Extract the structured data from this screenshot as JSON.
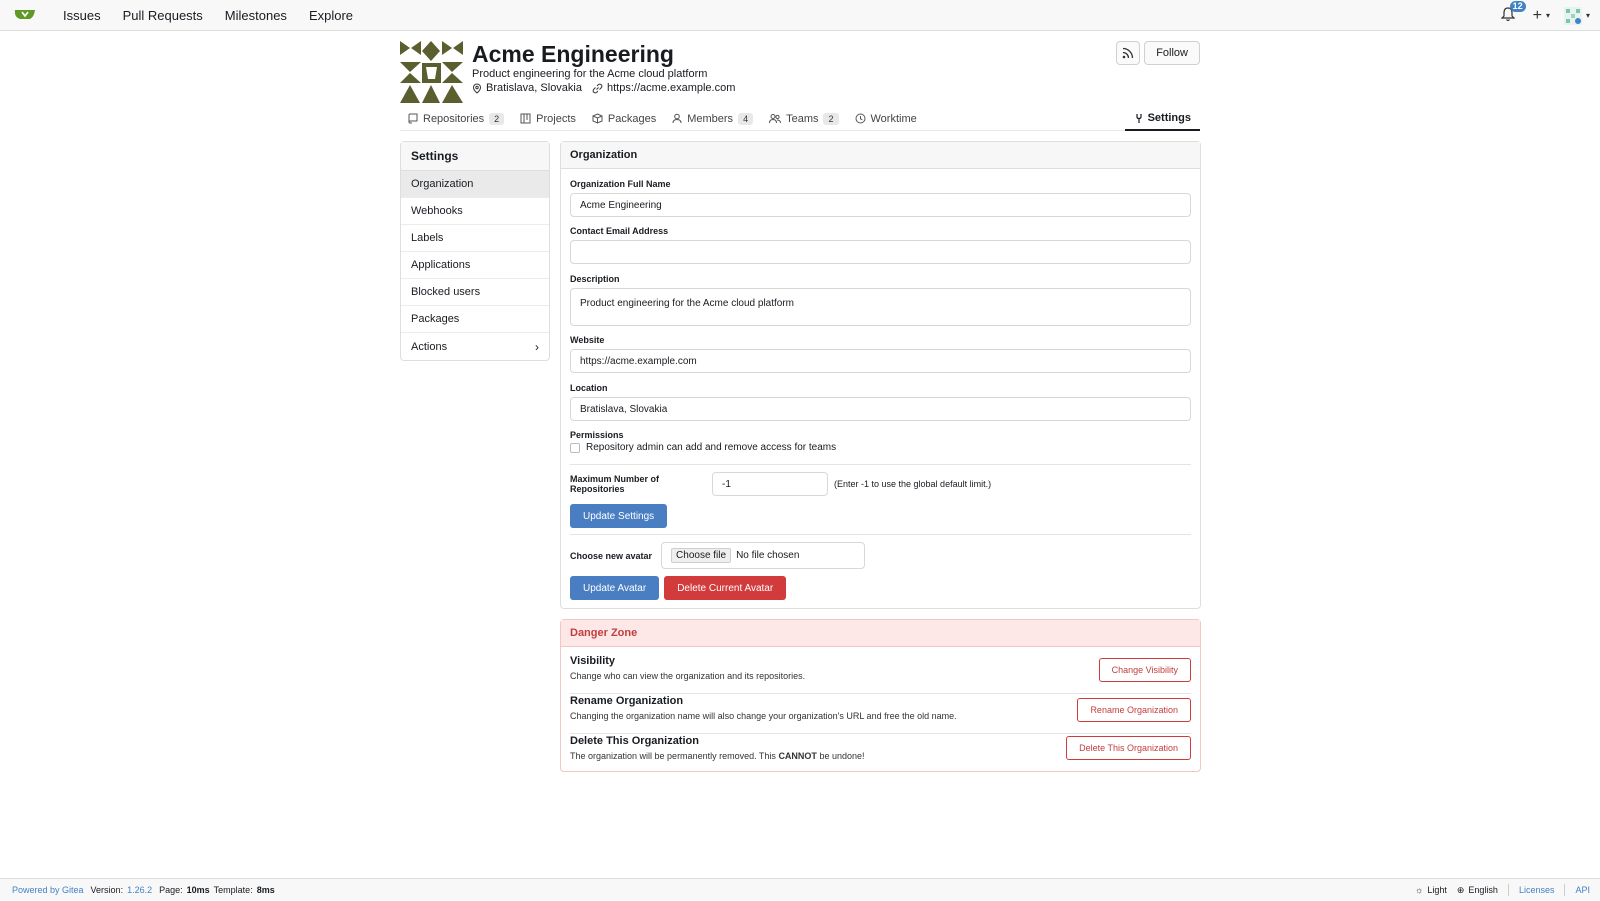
{
  "nav": {
    "links": [
      "Issues",
      "Pull Requests",
      "Milestones",
      "Explore"
    ],
    "notification_count": "12",
    "plus_label": "+"
  },
  "org": {
    "name": "Acme Engineering",
    "description": "Product engineering for the Acme cloud platform",
    "location": "Bratislava, Slovakia",
    "website": "https://acme.example.com",
    "follow_label": "Follow"
  },
  "tabs": [
    {
      "label": "Repositories",
      "count": "2"
    },
    {
      "label": "Projects"
    },
    {
      "label": "Packages"
    },
    {
      "label": "Members",
      "count": "4"
    },
    {
      "label": "Teams",
      "count": "2"
    },
    {
      "label": "Worktime"
    }
  ],
  "settings_tab": "Settings",
  "sidebar": {
    "title": "Settings",
    "items": [
      "Organization",
      "Webhooks",
      "Labels",
      "Applications",
      "Blocked users",
      "Packages",
      "Actions"
    ]
  },
  "form": {
    "title": "Organization",
    "full_name_label": "Organization Full Name",
    "full_name": "Acme Engineering",
    "email_label": "Contact Email Address",
    "email": "",
    "description_label": "Description",
    "description": "Product engineering for the Acme cloud platform",
    "website_label": "Website",
    "website": "https://acme.example.com",
    "location_label": "Location",
    "location": "Bratislava, Slovakia",
    "permissions_label": "Permissions",
    "permissions_checkbox": "Repository admin can add and remove access for teams",
    "max_repos_label": "Maximum Number of Repositories",
    "max_repos_value": "-1",
    "max_repos_hint": "(Enter -1 to use the global default limit.)",
    "update_settings": "Update Settings",
    "avatar_label": "Choose new avatar",
    "choose_file": "Choose file",
    "no_file": "No file chosen",
    "update_avatar": "Update Avatar",
    "delete_avatar": "Delete Current Avatar"
  },
  "danger": {
    "title": "Danger Zone",
    "visibility_title": "Visibility",
    "visibility_desc": "Change who can view the organization and its repositories.",
    "visibility_btn": "Change Visibility",
    "rename_title": "Rename Organization",
    "rename_desc": "Changing the organization name will also change your organization's URL and free the old name.",
    "rename_btn": "Rename Organization",
    "delete_title": "Delete This Organization",
    "delete_desc_pre": "The organization will be permanently removed. This ",
    "delete_desc_strong": "CANNOT",
    "delete_desc_post": " be undone!",
    "delete_btn": "Delete This Organization"
  },
  "footer": {
    "powered": "Powered by Gitea",
    "version_label": "Version:",
    "version": "1.26.2",
    "page_label": "Page:",
    "page_time": "10ms",
    "template_label": "Template:",
    "template_time": "8ms",
    "theme": "Light",
    "language": "English",
    "licenses": "Licenses",
    "api": "API"
  },
  "colors": {
    "accent": "#4a7ec3",
    "danger": "#d23b3b",
    "gitea_green": "#609926",
    "avatar_olive": "#5b5e2e"
  }
}
